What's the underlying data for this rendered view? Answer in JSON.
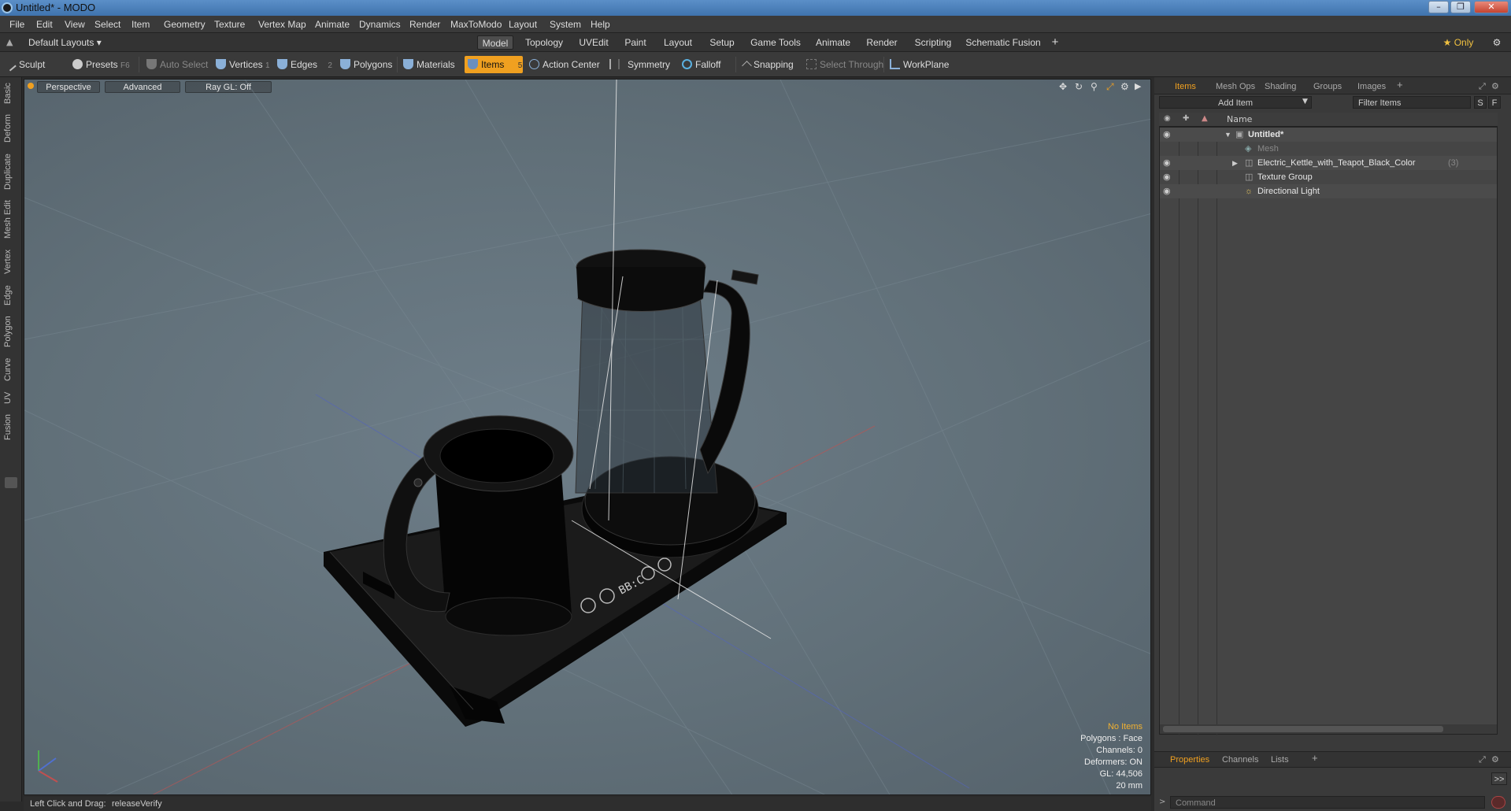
{
  "window": {
    "title": "Untitled* - MODO"
  },
  "menubar": [
    "File",
    "Edit",
    "View",
    "Select",
    "Item",
    "Geometry",
    "Texture",
    "Vertex Map",
    "Animate",
    "Dynamics",
    "Render",
    "MaxToModo",
    "Layout",
    "System",
    "Help"
  ],
  "layoutbar": {
    "layout_dropdown": "Default Layouts ▾",
    "tabs": [
      "Model",
      "Topology",
      "UVEdit",
      "Paint",
      "Layout",
      "Setup",
      "Game Tools",
      "Animate",
      "Render",
      "Scripting",
      "Schematic Fusion"
    ],
    "active_tab": "Model",
    "add": "+",
    "only_label": "★ Only"
  },
  "toolbar": {
    "sculpt": "Sculpt",
    "presets": "Presets",
    "presets_key": "F6",
    "auto_select": "Auto Select",
    "vertices": "Vertices",
    "vertices_key": "1",
    "edges": "Edges",
    "edges_key": "2",
    "polygons": "Polygons",
    "materials": "Materials",
    "items": "Items",
    "items_key": "5",
    "action_center": "Action Center",
    "symmetry": "Symmetry",
    "falloff": "Falloff",
    "snapping": "Snapping",
    "select_through": "Select Through",
    "workplane": "WorkPlane"
  },
  "lefttabs": [
    "Basic",
    "Deform",
    "Duplicate",
    "Mesh Edit",
    "Vertex",
    "Edge",
    "Polygon",
    "Curve",
    "UV",
    "Fusion"
  ],
  "viewport": {
    "view": "Perspective",
    "advanced": "Advanced",
    "raygl": "Ray GL: Off",
    "stats": {
      "no_items": "No Items",
      "polygons": "Polygons : Face",
      "channels": "Channels: 0",
      "deformers": "Deformers: ON",
      "gl": "GL: 44,506",
      "scale": "20 mm"
    },
    "display": "BB:C"
  },
  "statusbar": {
    "hint": "Left Click and Drag:",
    "action": "releaseVerify"
  },
  "itemspanel": {
    "tabs": [
      "Items",
      "Mesh Ops",
      "Shading",
      "Groups",
      "Images"
    ],
    "active_tab": "Items",
    "add_item": "Add Item",
    "filter_placeholder": "Filter Items",
    "s_btn": "S",
    "f_btn": "F",
    "col_name": "Name",
    "rows": [
      {
        "label": "Untitled*"
      },
      {
        "label": "Mesh"
      },
      {
        "label": "Electric_Kettle_with_Teapot_Black_Color",
        "count": "(3)"
      },
      {
        "label": "Texture Group"
      },
      {
        "label": "Directional Light"
      }
    ]
  },
  "properties": {
    "tabs": [
      "Properties",
      "Channels",
      "Lists"
    ],
    "active_tab": "Properties",
    "expand": ">>",
    "command_placeholder": "Command"
  }
}
